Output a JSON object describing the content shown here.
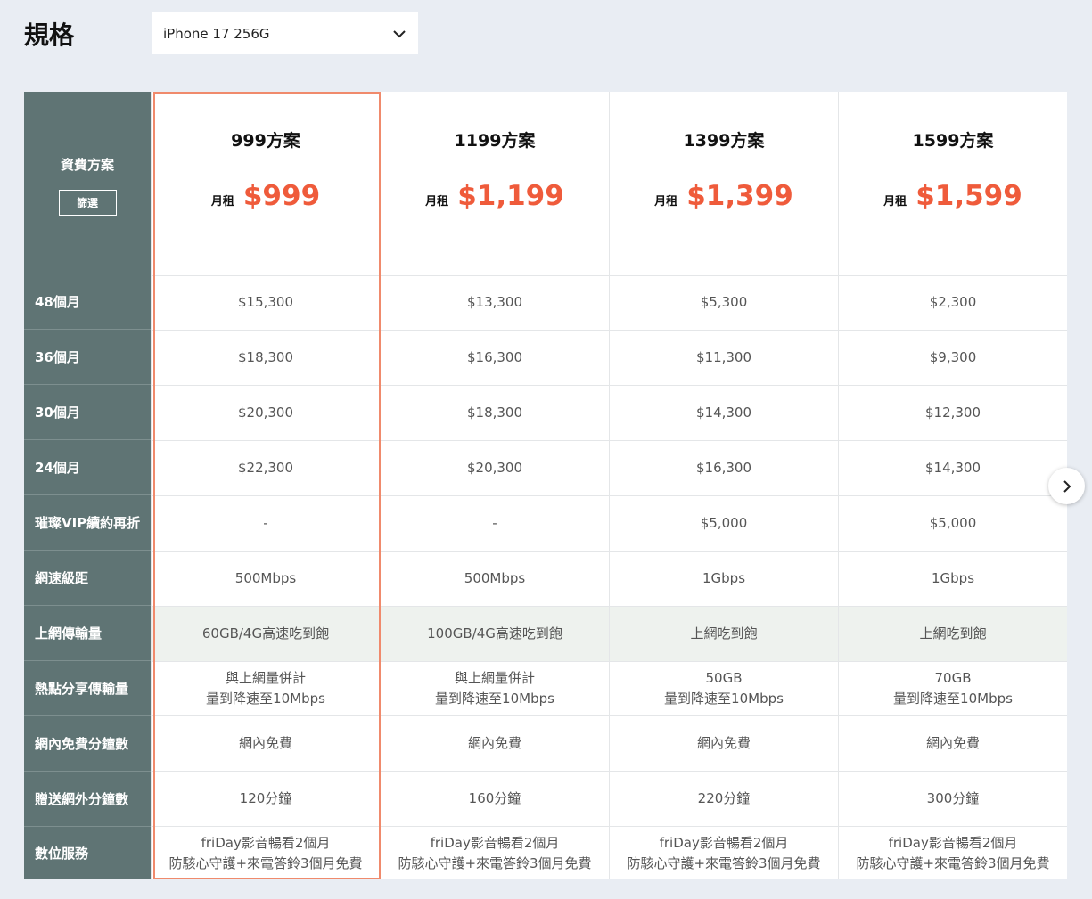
{
  "page_title": "規格",
  "device_select": {
    "value": "iPhone 17 256G"
  },
  "table": {
    "header_label": "資費方案",
    "filter_label": "篩選",
    "row_labels": [
      "48個月",
      "36個月",
      "30個月",
      "24個月",
      "璀璨VIP續約再折",
      "網速級距",
      "上網傳輸量",
      "熱點分享傳輸量",
      "網內免費分鐘數",
      "贈送網外分鐘數",
      "數位服務"
    ],
    "plans": [
      {
        "name": "999方案",
        "price_prefix": "月租",
        "price": "$999",
        "cells": [
          "$15,300",
          "$18,300",
          "$20,300",
          "$22,300",
          "-",
          "500Mbps",
          "60GB/4G高速吃到飽",
          "與上網量併計\n量到降速至10Mbps",
          "網內免費",
          "120分鐘",
          "friDay影音暢看2個月\n防駭心守護+來電答鈴3個月免費"
        ]
      },
      {
        "name": "1199方案",
        "price_prefix": "月租",
        "price": "$1,199",
        "cells": [
          "$13,300",
          "$16,300",
          "$18,300",
          "$20,300",
          "-",
          "500Mbps",
          "100GB/4G高速吃到飽",
          "與上網量併計\n量到降速至10Mbps",
          "網內免費",
          "160分鐘",
          "friDay影音暢看2個月\n防駭心守護+來電答鈴3個月免費"
        ]
      },
      {
        "name": "1399方案",
        "price_prefix": "月租",
        "price": "$1,399",
        "cells": [
          "$5,300",
          "$11,300",
          "$14,300",
          "$16,300",
          "$5,000",
          "1Gbps",
          "上網吃到飽",
          "50GB\n量到降速至10Mbps",
          "網內免費",
          "220分鐘",
          "friDay影音暢看2個月\n防駭心守護+來電答鈴3個月免費"
        ]
      },
      {
        "name": "1599方案",
        "price_prefix": "月租",
        "price": "$1,599",
        "cells": [
          "$2,300",
          "$9,300",
          "$12,300",
          "$14,300",
          "$5,000",
          "1Gbps",
          "上網吃到飽",
          "70GB\n量到降速至10Mbps",
          "網內免費",
          "300分鐘",
          "friDay影音暢看2個月\n防駭心守護+來電答鈴3個月免費"
        ]
      }
    ],
    "selected_plan": "999方案"
  },
  "icons": {
    "select": "chevron-down-icon",
    "next": "chevron-right-icon"
  },
  "colors": {
    "accent": "#ef5b3b",
    "label_bg": "#5f7474",
    "highlight_border": "#f08a6c",
    "shaded_row": "#eef2ee"
  }
}
